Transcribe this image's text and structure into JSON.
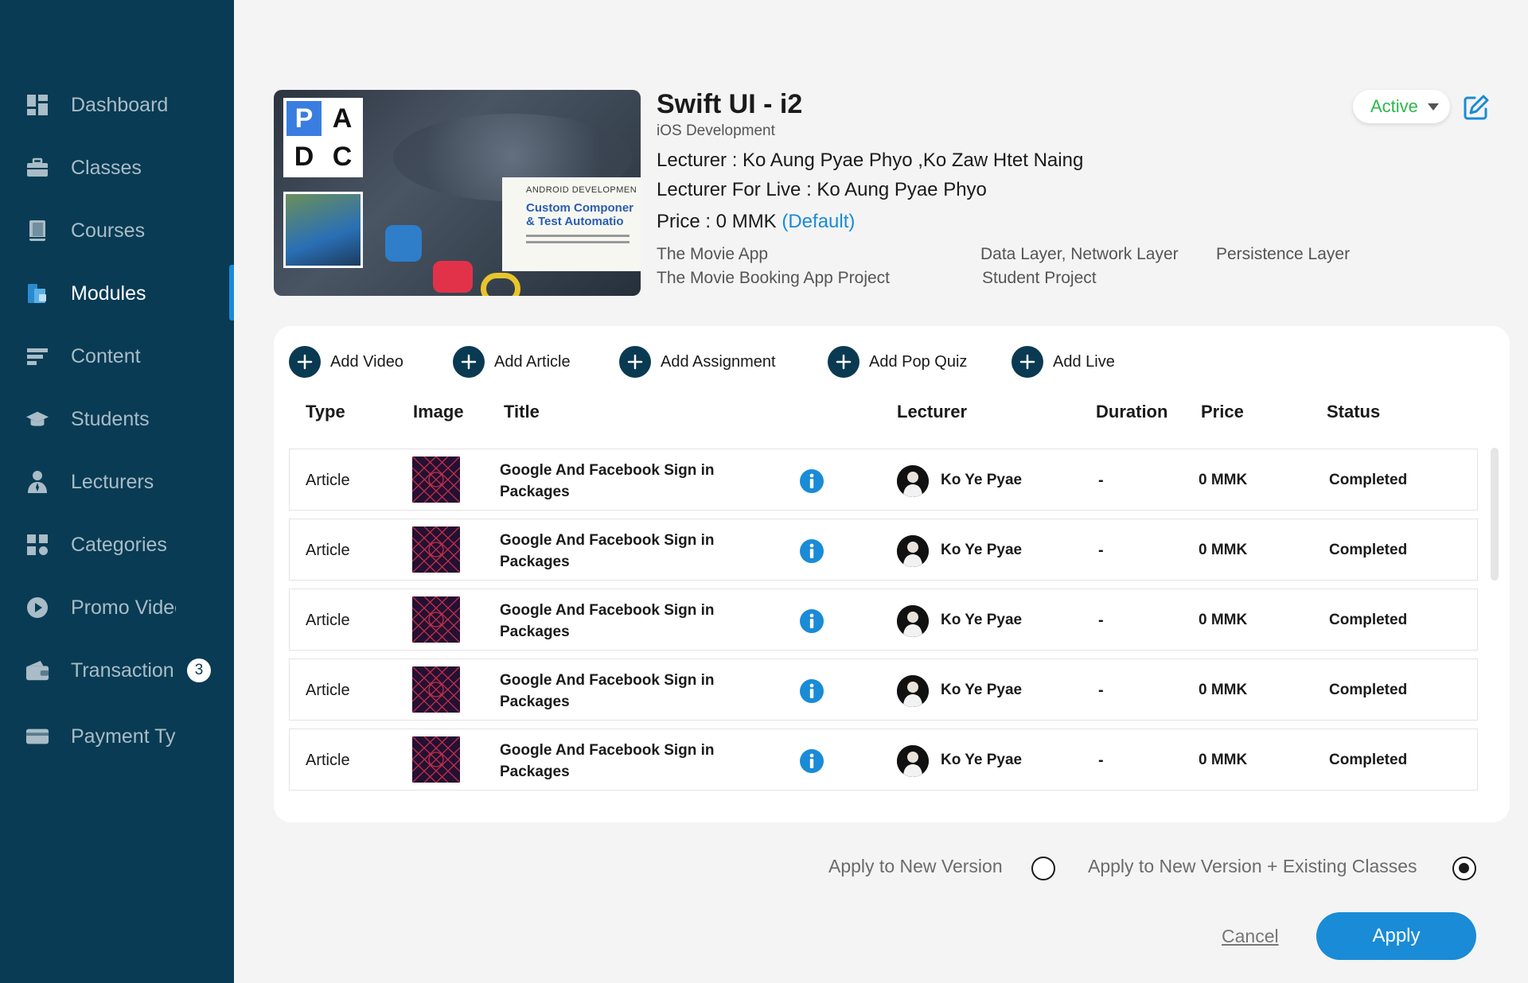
{
  "sidebar": {
    "items": [
      {
        "label": "Dashboard",
        "icon": "dashboard-icon"
      },
      {
        "label": "Classes",
        "icon": "briefcase-icon"
      },
      {
        "label": "Courses",
        "icon": "book-icon"
      },
      {
        "label": "Modules",
        "icon": "modules-icon"
      },
      {
        "label": "Content",
        "icon": "content-icon"
      },
      {
        "label": "Students",
        "icon": "graduation-cap-icon"
      },
      {
        "label": "Lecturers",
        "icon": "lecturer-icon"
      },
      {
        "label": "Categories",
        "icon": "categories-icon"
      },
      {
        "label": "Promo Videos",
        "icon": "play-icon"
      },
      {
        "label": "Transaction",
        "icon": "wallet-icon",
        "badge": "3"
      },
      {
        "label": "Payment Type",
        "icon": "card-icon"
      }
    ],
    "active": "Modules"
  },
  "thumbnail": {
    "letters": [
      "P",
      "A",
      "D",
      "C"
    ],
    "banner_line1": "ANDROID DEVELOPMEN",
    "banner_line2": "Custom Componer",
    "banner_line3": "& Test Automatio"
  },
  "course": {
    "title": "Swift UI - i2",
    "category": "iOS Development",
    "lecturer": "Lecturer : Ko Aung Pyae Phyo ,Ko Zaw Htet Naing",
    "lecturer_live": "Lecturer For Live : Ko Aung Pyae Phyo",
    "price_prefix": "Price : 0 MMK ",
    "price_default": "(Default)",
    "meta": {
      "col1_line1": "The Movie App",
      "col1_line2": "The Movie Booking App Project",
      "col2_line1": "Data Layer, Network Layer",
      "col2_line2": "Student Project",
      "col3_line1": "Persistence Layer"
    },
    "status": "Active"
  },
  "actions": {
    "add_video": "Add Video",
    "add_article": "Add Article",
    "add_assignment": "Add Assignment",
    "add_pop_quiz": "Add Pop Quiz",
    "add_live": "Add Live"
  },
  "table": {
    "headers": {
      "type": "Type",
      "image": "Image",
      "title": "Title",
      "lecturer": "Lecturer",
      "duration": "Duration",
      "price": "Price",
      "status": "Status"
    },
    "rows": [
      {
        "type": "Article",
        "title_line1": "Google And Facebook Sign in",
        "title_line2": "Packages",
        "lecturer": "Ko Ye Pyae",
        "duration": "-",
        "price": "0 MMK",
        "status": "Completed"
      },
      {
        "type": "Article",
        "title_line1": "Google And Facebook Sign in",
        "title_line2": "Packages",
        "lecturer": "Ko Ye Pyae",
        "duration": "-",
        "price": "0 MMK",
        "status": "Completed"
      },
      {
        "type": "Article",
        "title_line1": "Google And Facebook Sign in",
        "title_line2": "Packages",
        "lecturer": "Ko Ye Pyae",
        "duration": "-",
        "price": "0 MMK",
        "status": "Completed"
      },
      {
        "type": "Article",
        "title_line1": "Google And Facebook Sign in",
        "title_line2": "Packages",
        "lecturer": "Ko Ye Pyae",
        "duration": "-",
        "price": "0 MMK",
        "status": "Completed"
      },
      {
        "type": "Article",
        "title_line1": "Google And Facebook Sign in",
        "title_line2": "Packages",
        "lecturer": "Ko Ye Pyae",
        "duration": "-",
        "price": "0 MMK",
        "status": "Completed"
      }
    ]
  },
  "footer": {
    "option_new_version": "Apply to New Version",
    "option_new_version_existing": "Apply to New Version + Existing Classes",
    "selected_option": "option_new_version_existing",
    "cancel": "Cancel",
    "apply": "Apply"
  },
  "colors": {
    "sidebar_bg": "#093b54",
    "accent": "#1a8bd6",
    "active_status": "#2db84d"
  }
}
